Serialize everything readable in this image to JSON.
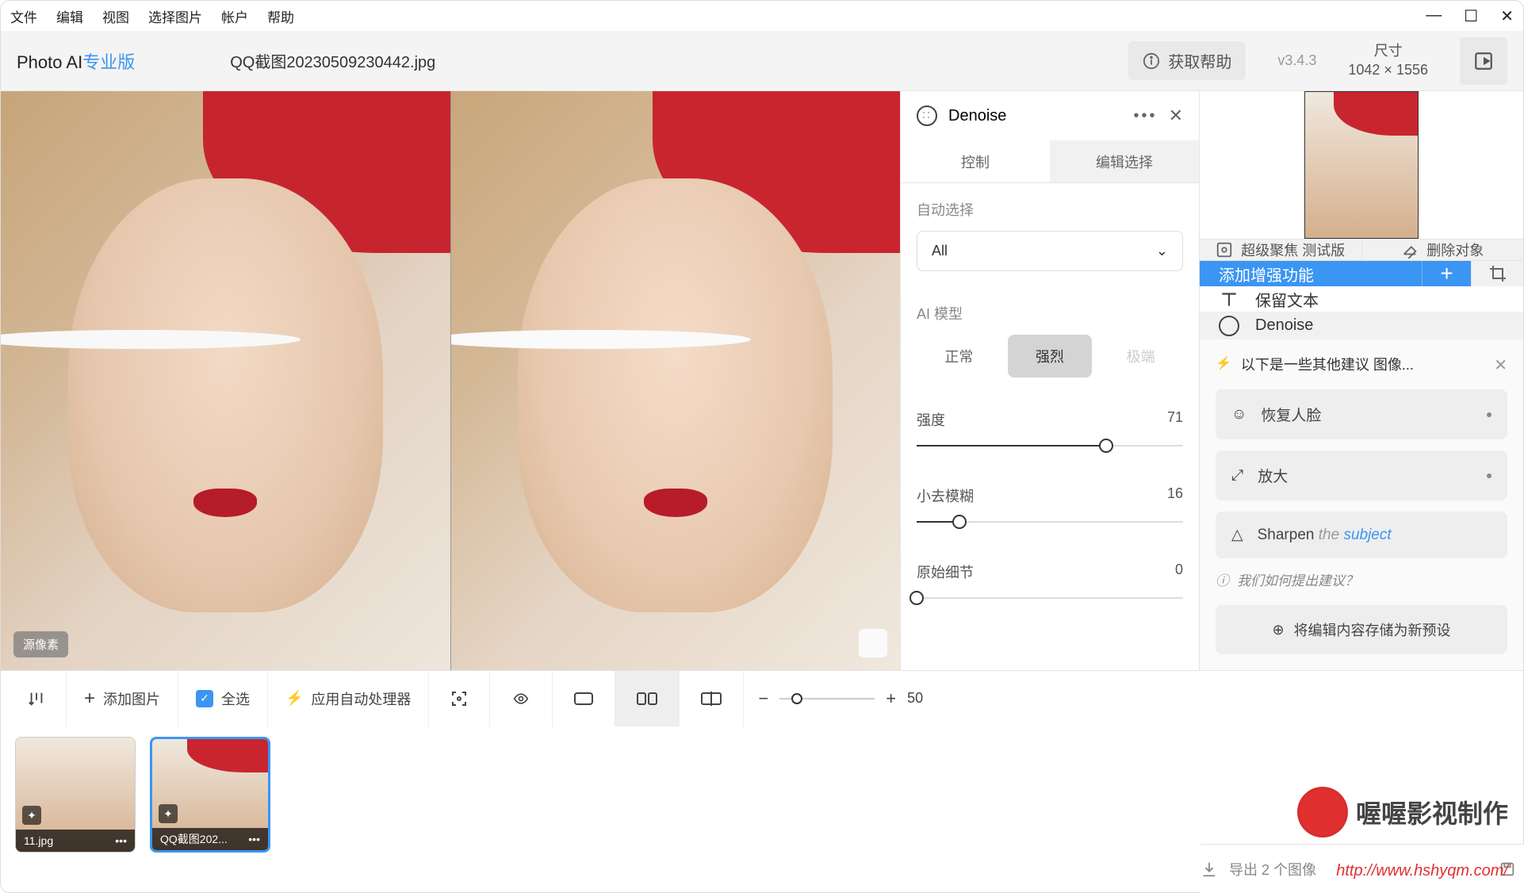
{
  "menu": {
    "items": [
      "文件",
      "编辑",
      "视图",
      "选择图片",
      "帐户",
      "帮助"
    ]
  },
  "brand": {
    "name": "Photo AI",
    "edition": "专业版"
  },
  "filename": "QQ截图20230509230442.jpg",
  "help_button": "获取帮助",
  "version": "v3.4.3",
  "dimensions": {
    "label": "尺寸",
    "value": "1042 × 1556"
  },
  "preview": {
    "left_tag": "源像素",
    "right_tag": "✓"
  },
  "panel": {
    "title": "Denoise",
    "tabs": {
      "control": "控制",
      "edit_select": "编辑选择"
    },
    "auto_select": {
      "label": "自动选择",
      "value": "All"
    },
    "ai_model": {
      "label": "AI 模型",
      "options": [
        "正常",
        "强烈",
        "极端"
      ],
      "selected": 1
    },
    "sliders": {
      "intensity": {
        "label": "强度",
        "value": 71
      },
      "deblur": {
        "label": "小去模糊",
        "value": 16
      },
      "detail": {
        "label": "原始细节",
        "value": 0
      }
    }
  },
  "right": {
    "superfocus": "超级聚焦 测试版",
    "remove_obj": "删除对象",
    "add_enhance": "添加增强功能",
    "preserve_text": "保留文本",
    "denoise": "Denoise",
    "suggest_hdr": "以下是一些其他建议 图像...",
    "suggest": {
      "face": "恢复人脸",
      "enlarge": "放大",
      "sharpen": "Sharpen",
      "sharpen_the": "the",
      "sharpen_subj": "subject"
    },
    "help": "我们如何提出建议？",
    "preset": "将编辑内容存储为新预设"
  },
  "bottombar": {
    "add_image": "添加图片",
    "select_all": "全选",
    "autoprocess": "应用自动处理器",
    "zoom_pct": "50"
  },
  "filmstrip": [
    {
      "name": "11.jpg",
      "selected": false
    },
    {
      "name": "QQ截图202...",
      "selected": true
    }
  ],
  "export": "导出 2 个图像",
  "watermark": {
    "text": "喔喔影视制作",
    "url": "http://www.hshyqm.com/"
  }
}
